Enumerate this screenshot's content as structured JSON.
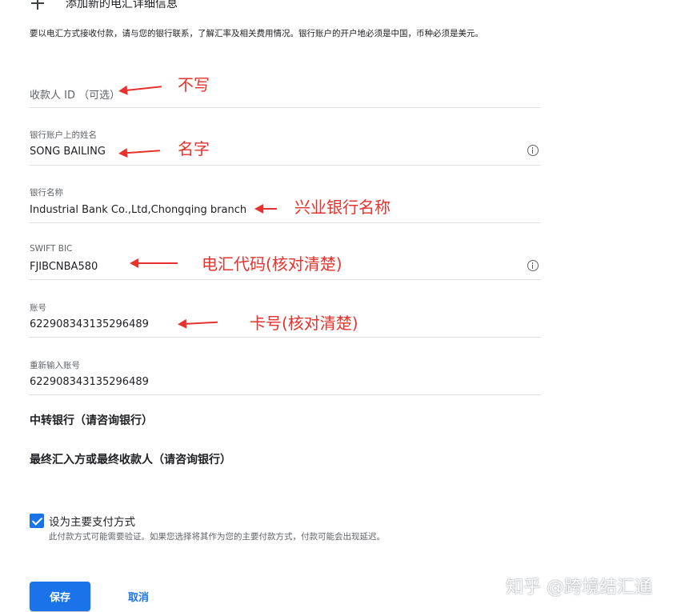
{
  "header": {
    "title": "添加新的电汇详细信息",
    "icon": "plus-icon"
  },
  "intro": "要以电汇方式接收付款，请与您的银行联系，了解汇率及相关费用情况。银行账户的开户地必须是中国，币种必须是美元。",
  "fields": {
    "payee_id": {
      "placeholder": "收款人 ID （可选）"
    },
    "account_name": {
      "label": "银行账户上的姓名",
      "value": "SONG BAILING"
    },
    "bank_name": {
      "label": "银行名称",
      "value": "Industrial Bank Co.,Ltd,Chongqing branch"
    },
    "swift": {
      "label": "SWIFT BIC",
      "value": "FJIBCNBA580"
    },
    "account_number": {
      "label": "账号",
      "value": "622908343135296489"
    },
    "account_number_confirm": {
      "label": "重新输入账号",
      "value": "622908343135296489"
    }
  },
  "sections": {
    "intermediary_bank": "中转银行（请咨询银行）",
    "final_beneficiary": "最终汇入方或最终收款人（请咨询银行）"
  },
  "primary_payment": {
    "checked": true,
    "label": "设为主要支付方式",
    "help": "此付款方式可能需要验证。如果您选择将其作为您的主要付款方式，付款可能会出现延迟。"
  },
  "buttons": {
    "save": "保存",
    "cancel": "取消"
  },
  "annotations": {
    "payee_id": "不写",
    "account_name": "名字",
    "bank_name": "兴业银行名称",
    "swift": "电汇代码(核对清楚)",
    "account_number": "卡号(核对清楚)"
  },
  "watermark": "知乎 @跨境结汇通",
  "colors": {
    "accent": "#1a73e8",
    "annotation": "#e8322d",
    "divider": "#dadce0"
  }
}
